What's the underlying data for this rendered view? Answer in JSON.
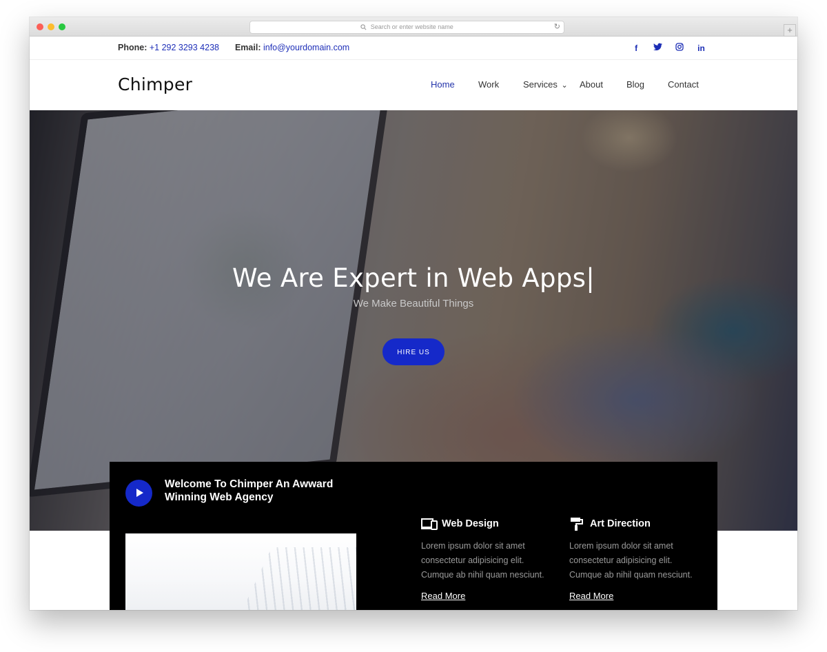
{
  "browser": {
    "address_placeholder": "Search or enter website name",
    "reload_glyph": "↻",
    "new_tab_glyph": "+"
  },
  "topbar": {
    "phone_label": "Phone:",
    "phone_value": "+1 292 3293 4238",
    "email_label": "Email:",
    "email_value": "info@yourdomain.com",
    "social": [
      {
        "icon": "facebook-icon",
        "glyph": "f"
      },
      {
        "icon": "twitter-icon",
        "glyph": "t"
      },
      {
        "icon": "instagram-icon",
        "glyph": "◎"
      },
      {
        "icon": "linkedin-icon",
        "glyph": "in"
      }
    ]
  },
  "nav": {
    "logo": "Chimper",
    "items": [
      "Home",
      "Work",
      "Services",
      "About",
      "Blog",
      "Contact"
    ],
    "dropdown_glyph": "⌄",
    "active": "Home"
  },
  "hero": {
    "title": "We Are Expert in Web Apps",
    "cursor": "|",
    "subtitle": "We Make Beautiful Things",
    "cta": "HIRE US"
  },
  "welcome": {
    "title": "Welcome To Chimper An Awward Winning Web Agency",
    "services": [
      {
        "icon": "devices-icon",
        "title": "Web Design",
        "desc": "Lorem ipsum dolor sit amet consectetur adipisicing elit. Cumque ab nihil quam nesciunt.",
        "link": "Read More"
      },
      {
        "icon": "paint-roller-icon",
        "title": "Art Direction",
        "desc": "Lorem ipsum dolor sit amet consectetur adipisicing elit. Cumque ab nihil quam nesciunt.",
        "link": "Read More"
      }
    ]
  },
  "colors": {
    "accent": "#1529c9",
    "link": "#1e2fb8",
    "dark_panel": "#000000"
  }
}
